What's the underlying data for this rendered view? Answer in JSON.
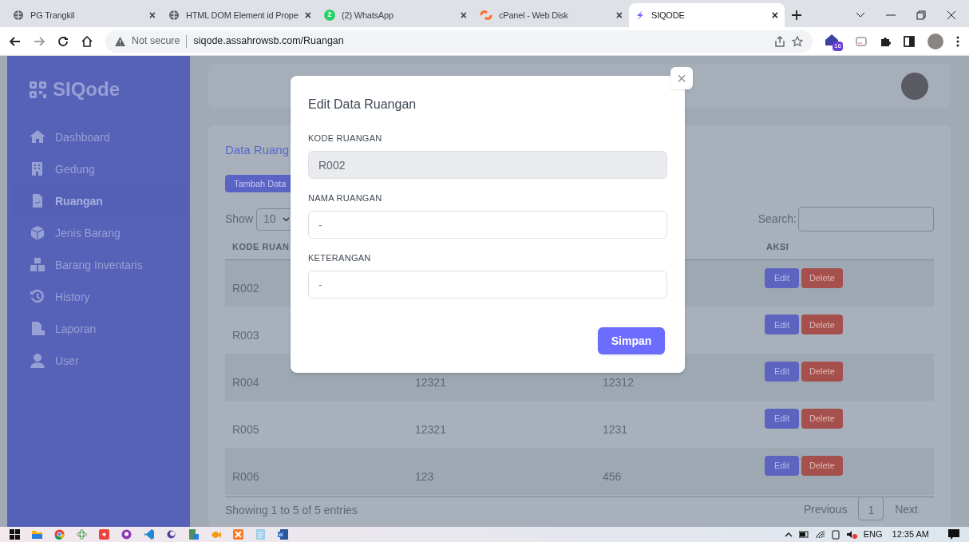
{
  "browser": {
    "tabs": [
      {
        "title": "PG Trangkil",
        "close": "×",
        "selected": false
      },
      {
        "title": "HTML DOM Element id Prope",
        "close": "×",
        "selected": false
      },
      {
        "title": "(2) WhatsApp",
        "badge": "2",
        "close": "×",
        "selected": false
      },
      {
        "title": "cPanel - Web Disk",
        "close": "×",
        "selected": false
      },
      {
        "title": "SIQODE",
        "close": "×",
        "selected": true
      }
    ],
    "security": "Not secure",
    "url": "siqode.assahrowsb.com/Ruangan",
    "extension_badge": "16"
  },
  "sidebar": {
    "brand": "SIQode",
    "items": [
      {
        "label": "Dashboard",
        "selected": false
      },
      {
        "label": "Gedung",
        "selected": false
      },
      {
        "label": "Ruangan",
        "selected": true
      },
      {
        "label": "Jenis Barang",
        "selected": false
      },
      {
        "label": "Barang Inventaris",
        "selected": false
      },
      {
        "label": "History",
        "selected": false
      },
      {
        "label": "Laporan",
        "selected": false
      },
      {
        "label": "User",
        "selected": false
      }
    ]
  },
  "card": {
    "title": "Data Ruang",
    "add_button": "Tambah Data",
    "show_label": "Show",
    "show_value": "10",
    "search_label": "Search:",
    "columns": {
      "column_1": "KODE RUAN",
      "column_4": "AKSI"
    },
    "rows": [
      {
        "cells": [
          "R002"
        ],
        "edit": "Edit",
        "delete": "Delete"
      },
      {
        "cells": [
          "R003"
        ],
        "edit": "Edit",
        "delete": "Delete"
      },
      {
        "cells": [
          "R004",
          "12321",
          "12312"
        ],
        "edit": "Edit",
        "delete": "Delete"
      },
      {
        "cells": [
          "R005",
          "12321",
          "1231"
        ],
        "edit": "Edit",
        "delete": "Delete"
      },
      {
        "cells": [
          "R006",
          "123",
          "456"
        ],
        "edit": "Edit",
        "delete": "Delete"
      }
    ],
    "info": "Showing 1 to 5 of 5 entries",
    "pagination": [
      {
        "label": "Previous",
        "selected": false
      },
      {
        "label": "1",
        "selected": true
      },
      {
        "label": "Next",
        "selected": false
      }
    ]
  },
  "modal": {
    "title": "Edit Data Ruangan",
    "close": "×",
    "fields": [
      {
        "label": "KODE RUANGAN",
        "value": "R002",
        "disabled": true
      },
      {
        "label": "NAMA RUANGAN",
        "value": "-",
        "disabled": false
      },
      {
        "label": "KETERANGAN",
        "value": "-",
        "disabled": false
      }
    ],
    "submit": "Simpan"
  },
  "taskbar": {
    "language": "ENG",
    "time": "12:35 AM"
  }
}
